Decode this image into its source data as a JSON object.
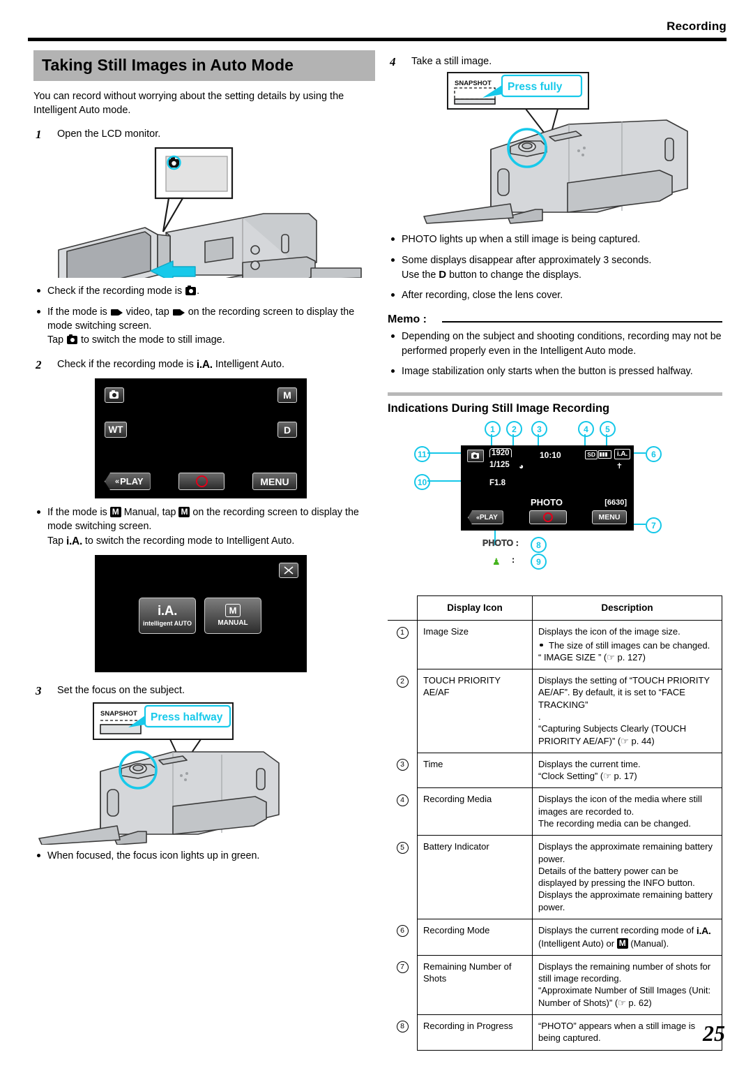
{
  "header": {
    "title": "Recording"
  },
  "page_number": "25",
  "section": {
    "title": "Taking Still Images in Auto Mode",
    "lead": "You can record without worrying about the setting details by using the Intelligent Auto mode."
  },
  "steps": {
    "s1": {
      "num": "1",
      "text": "Open the LCD monitor."
    },
    "s2": {
      "num": "2",
      "text_a": "Check if the recording mode is ",
      "text_b": " Intelligent Auto.",
      "ia": "i.A."
    },
    "s3": {
      "num": "3",
      "text": "Set the focus on the subject."
    },
    "s4": {
      "num": "4",
      "text": "Take a still image."
    }
  },
  "bullets_step1": [
    {
      "pre": "Check if the recording mode is ",
      "post": "."
    },
    {
      "pre": "If the mode is ",
      "mid": " video, tap ",
      "post": " on the recording screen to display the mode switching screen.",
      "extra_pre": "Tap ",
      "extra_post": " to switch the mode to still image."
    }
  ],
  "bullets_step2": {
    "pre": "If the mode is ",
    "mid": " Manual, tap ",
    "post": " on the recording screen to display the mode switching screen.",
    "extra_pre": "Tap ",
    "extra_ia": "i.A.",
    "extra_post": " to switch the recording mode to Intelligent Auto."
  },
  "bullets_step3": [
    "When focused, the focus icon lights up in green."
  ],
  "bullets_step4": [
    {
      "text": "PHOTO lights up when a still image is being captured."
    },
    {
      "text": "Some displays disappear after approximately 3 seconds.",
      "line2_pre": "Use the ",
      "line2_key": "D",
      "line2_post": " button to change the displays."
    },
    {
      "text": "After recording, close the lens cover."
    }
  ],
  "memo": {
    "label": "Memo :",
    "items": [
      "Depending on the subject and shooting conditions, recording may not be performed properly even in the Intelligent Auto mode.",
      "Image stabilization only starts when the button is pressed halfway."
    ]
  },
  "callouts": {
    "press_halfway": "Press halfway",
    "press_fully": "Press fully",
    "snapshot_label": "SNAPSHOT"
  },
  "lcd_rec_screen": {
    "still_icon": "still-image-icon",
    "manual": "M",
    "wt": "WT",
    "display": "D",
    "play": "PLAY",
    "menu": "MENU",
    "record_button": "record-shutter-button"
  },
  "lcd_mode_screen": {
    "close": "X",
    "option_auto_main": "i.A.",
    "option_auto_sub": "intelligent AUTO",
    "option_manual_main": "M",
    "option_manual_sub": "MANUAL"
  },
  "indications": {
    "heading": "Indications During Still Image Recording",
    "osd": {
      "image_size": "1920",
      "shutter": "1/125",
      "aperture": "F1.8",
      "time": "10:10",
      "media": "SD",
      "mode": "i.A.",
      "remaining": "[6630]",
      "photo": "PHOTO",
      "play": "PLAY",
      "menu": "MENU"
    },
    "legend": {
      "photo_label": "PHOTO :",
      "photo_num": "8",
      "focus_num": "9"
    },
    "numbers": [
      "1",
      "2",
      "3",
      "4",
      "5",
      "6",
      "7",
      "10",
      "11"
    ]
  },
  "table": {
    "headers": {
      "num": "",
      "icon": "Display Icon",
      "desc": "Description"
    },
    "rows": [
      {
        "num": "1",
        "icon": "Image Size",
        "lines": [
          "Displays the icon of the image size."
        ],
        "bullet": "The size of still images can be changed.",
        "ref": "“ IMAGE SIZE ” (☞ p. 127)"
      },
      {
        "num": "2",
        "icon": "TOUCH PRIORITY AE/AF",
        "lines": [
          "Displays the setting of “TOUCH PRIORITY AE/AF”. By default, it is set to “FACE TRACKING”",
          "."
        ],
        "ref": "“Capturing Subjects Clearly (TOUCH PRIORITY AE/AF)” (☞ p. 44)"
      },
      {
        "num": "3",
        "icon": "Time",
        "lines": [
          "Displays the current time."
        ],
        "ref": "“Clock Setting” (☞ p. 17)"
      },
      {
        "num": "4",
        "icon": "Recording Media",
        "lines": [
          "Displays the icon of the media where still images are recorded to.",
          "The recording media can be changed."
        ]
      },
      {
        "num": "5",
        "icon": "Battery Indicator",
        "lines": [
          "Displays the approximate remaining battery power.",
          "Details of the battery power can be displayed by pressing the INFO button.",
          "Displays the approximate remaining battery power."
        ]
      },
      {
        "num": "6",
        "icon": "Recording Mode",
        "special": "recording_mode",
        "lines": [
          "Displays the current recording mode of i.A. (Intelligent Auto) or M (Manual)."
        ]
      },
      {
        "num": "7",
        "icon": "Remaining Number of Shots",
        "lines": [
          "Displays the remaining number of shots for still image recording."
        ],
        "ref": "“Approximate Number of Still Images (Unit: Number of Shots)” (☞ p. 62)"
      },
      {
        "num": "8",
        "icon": "Recording in Progress",
        "lines": [
          "“PHOTO” appears when a still image is being captured."
        ]
      }
    ]
  }
}
